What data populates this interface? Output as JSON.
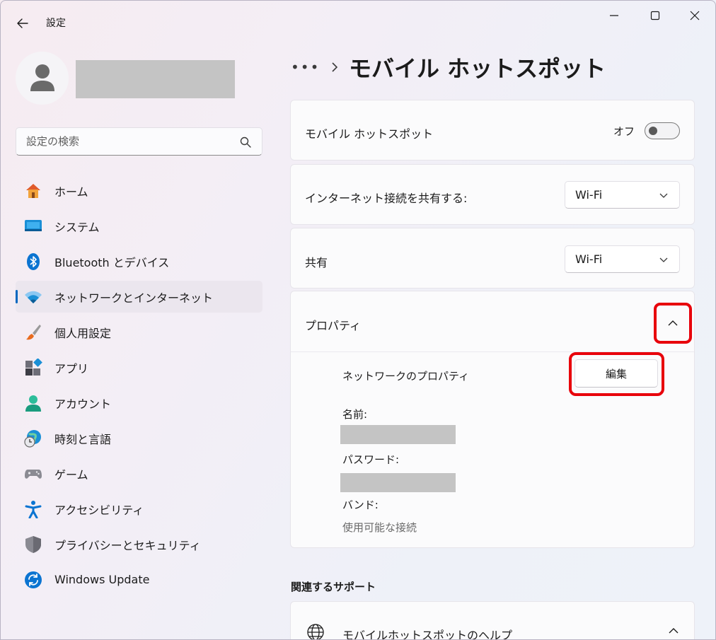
{
  "window": {
    "title": "設定",
    "controls": [
      "minimize-icon",
      "maximize-icon",
      "close-icon"
    ]
  },
  "sidebar": {
    "search": {
      "placeholder": "設定の検索",
      "value": ""
    },
    "items": [
      {
        "label": "ホーム",
        "icon": "home-icon"
      },
      {
        "label": "システム",
        "icon": "system-icon"
      },
      {
        "label": "Bluetooth とデバイス",
        "icon": "bluetooth-icon"
      },
      {
        "label": "ネットワークとインターネット",
        "icon": "wifi-icon",
        "active": true
      },
      {
        "label": "個人用設定",
        "icon": "brush-icon"
      },
      {
        "label": "アプリ",
        "icon": "apps-icon"
      },
      {
        "label": "アカウント",
        "icon": "account-icon"
      },
      {
        "label": "時刻と言語",
        "icon": "time-language-icon"
      },
      {
        "label": "ゲーム",
        "icon": "gamepad-icon"
      },
      {
        "label": "アクセシビリティ",
        "icon": "accessibility-icon"
      },
      {
        "label": "プライバシーとセキュリティ",
        "icon": "shield-icon"
      },
      {
        "label": "Windows Update",
        "icon": "update-icon"
      }
    ]
  },
  "main": {
    "breadcrumb_more": "•••",
    "page_title": "モバイル ホットスポット",
    "hotspot": {
      "label": "モバイル ホットスポット",
      "toggle_state": "オフ"
    },
    "share_from": {
      "label": "インターネット接続を共有する:",
      "value": "Wi-Fi"
    },
    "share_over": {
      "label": "共有",
      "value": "Wi-Fi"
    },
    "properties": {
      "label": "プロパティ",
      "network_props_label": "ネットワークのプロパティ",
      "edit_label": "編集",
      "name_label": "名前:",
      "password_label": "パスワード:",
      "band_label": "バンド:",
      "band_value": "使用可能な接続"
    },
    "related_support": {
      "title": "関連するサポート",
      "help_label": "モバイルホットスポットのヘルプ"
    }
  },
  "colors": {
    "accent": "#0067c0",
    "highlight": "#e8000b"
  }
}
